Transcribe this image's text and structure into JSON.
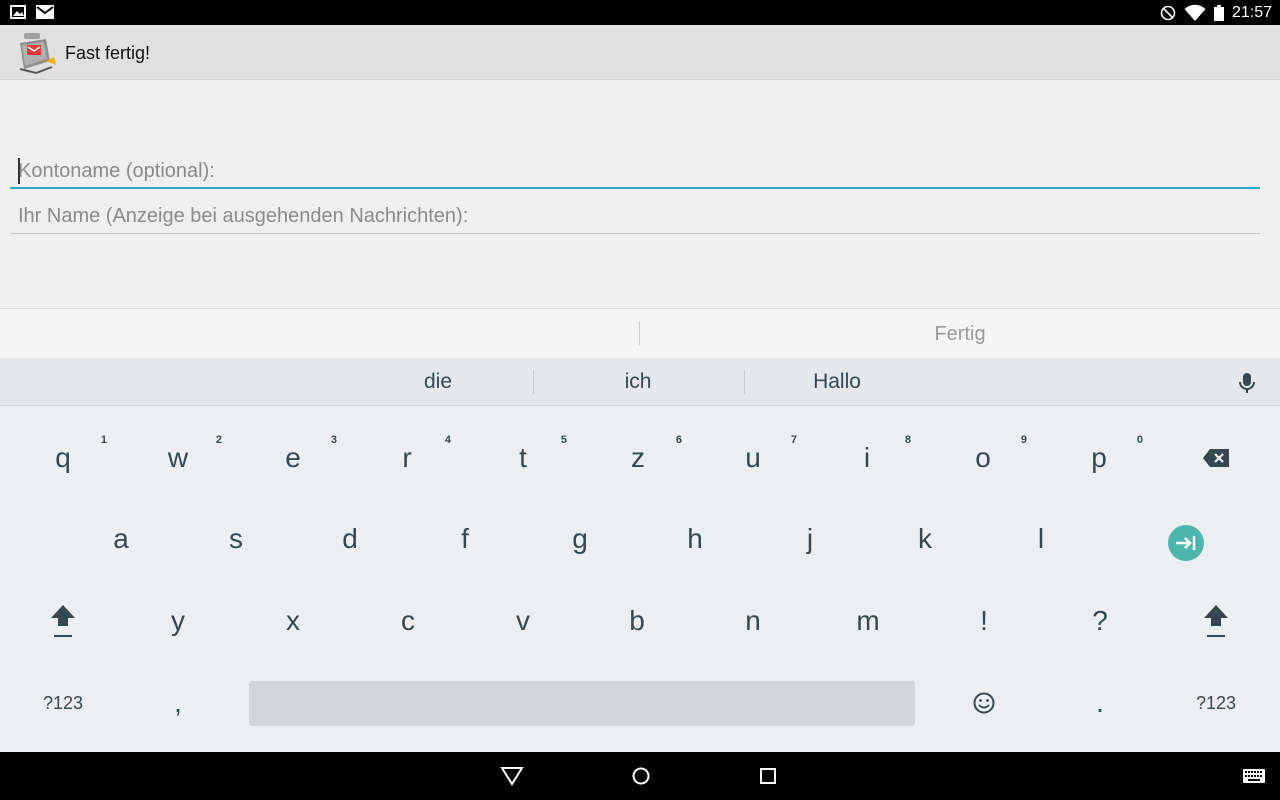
{
  "status_bar": {
    "time": "21:57"
  },
  "app": {
    "title": "Fast fertig!"
  },
  "form": {
    "account_name_placeholder": "Kontoname (optional):",
    "your_name_placeholder": "Ihr Name (Anzeige bei ausgehenden Nachrichten):"
  },
  "ime": {
    "done_label": "Fertig"
  },
  "keyboard": {
    "suggestions": [
      "die",
      "ich",
      "Hallo"
    ],
    "row1": [
      {
        "k": "q",
        "h": "1"
      },
      {
        "k": "w",
        "h": "2"
      },
      {
        "k": "e",
        "h": "3"
      },
      {
        "k": "r",
        "h": "4"
      },
      {
        "k": "t",
        "h": "5"
      },
      {
        "k": "z",
        "h": "6"
      },
      {
        "k": "u",
        "h": "7"
      },
      {
        "k": "i",
        "h": "8"
      },
      {
        "k": "o",
        "h": "9"
      },
      {
        "k": "p",
        "h": "0"
      }
    ],
    "row2": [
      "a",
      "s",
      "d",
      "f",
      "g",
      "h",
      "j",
      "k",
      "l"
    ],
    "row3": [
      "y",
      "x",
      "c",
      "v",
      "b",
      "n",
      "m",
      "!",
      "?"
    ],
    "symbols_label": "?123",
    "comma": ",",
    "period": ".",
    "accent_color": "#4db6ac"
  }
}
